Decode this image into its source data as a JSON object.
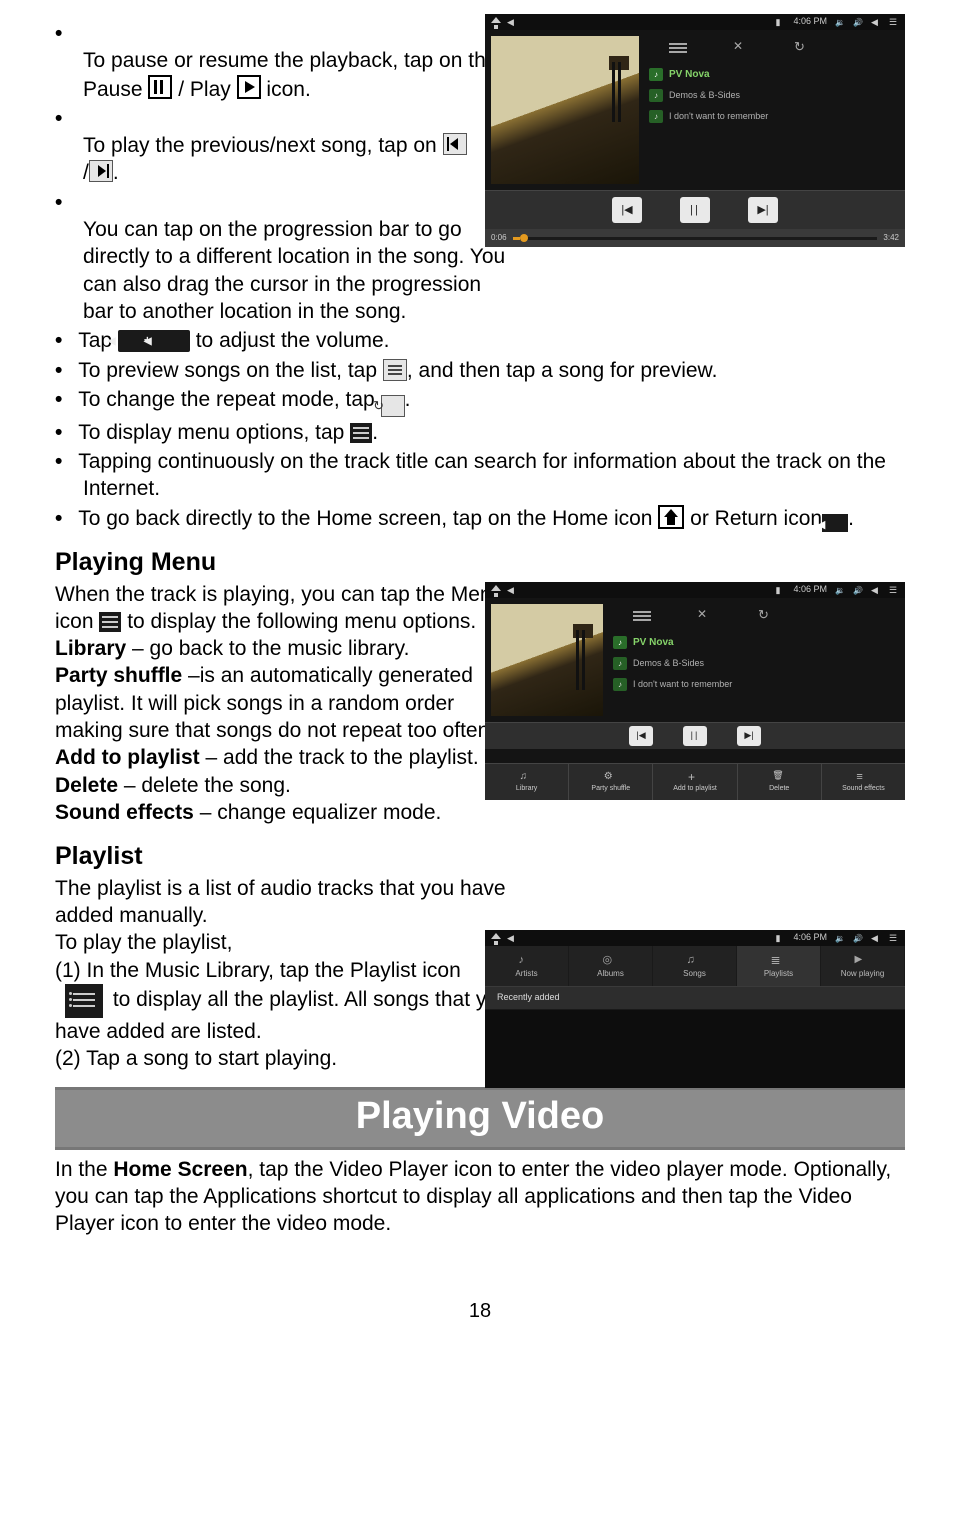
{
  "bullets": {
    "b1a": "To pause or resume the playback, tap on the Pause ",
    "b1b": " / Play ",
    "b1c": " icon.",
    "b2a": "To play the previous/next song, tap on ",
    "b2b": "/",
    "b2c": ".",
    "b3": "You can tap on the progression bar to go directly to a different location in the song. You can also drag the cursor in the progression bar to another location in the song.",
    "b4a": "Tap ",
    "b4b": " to adjust the volume.",
    "b5a": "To preview songs on the list, tap ",
    "b5b": ", and then tap a song for preview.",
    "b6a": "To change the repeat mode, tap ",
    "b6b": ".",
    "b7a": "To display menu options, tap ",
    "b7b": ".",
    "b8": "Tapping continuously on the track title can search for information about the track on the Internet.",
    "b9a": "To go back directly to the Home screen, tap on the Home icon ",
    "b9b": " or Return icon",
    "b9c": "."
  },
  "playingMenu": {
    "title": "Playing Menu",
    "intro_a": "When the track is playing, you can tap the Menu icon ",
    "intro_b": " to display the following menu options.",
    "lib_label": "Library",
    "lib_text": " – go back to the music library.",
    "ps_label": "Party shuffle",
    "ps_text": " –is an automatically generated playlist. It will pick songs in a random order making sure that songs do not repeat too often.",
    "add_label": "Add to playlist",
    "add_text": " – add the track to the playlist.",
    "del_label": "Delete",
    "del_text": " – delete the song.",
    "sfx_label": "Sound effects",
    "sfx_text": " – change equalizer mode."
  },
  "playlist": {
    "title": "Playlist",
    "intro": "The playlist is a list of audio tracks that you have added manually.",
    "line2": "To play the playlist,",
    "step1a": "(1) In the Music Library, tap the Playlist icon",
    "step1b": " to display all the playlist. All songs that you have added are listed.",
    "step2": "(2) Tap a song to start playing."
  },
  "banner": "Playing Video",
  "video_p_a": "In the ",
  "video_home": "Home Screen",
  "video_p_b": ", tap the Video Player icon to enter the video player mode. Optionally, you can tap the Applications shortcut to display all applications and then tap the Video Player icon to enter the video mode.",
  "pageNum": "18",
  "shots": {
    "time": "4:06 PM",
    "track1": "PV Nova",
    "track2": "Demos & B-Sides",
    "track3": "I don't want to remember",
    "pos": "0:06",
    "dur": "3:42",
    "menu": {
      "m1": "Library",
      "m2": "Party shuffle",
      "m3": "Add to playlist",
      "m4": "Delete",
      "m5": "Sound effects"
    },
    "tabs": {
      "t1": "Artists",
      "t2": "Albums",
      "t3": "Songs",
      "t4": "Playlists",
      "t5": "Now playing"
    },
    "plrow": "Recently added"
  }
}
